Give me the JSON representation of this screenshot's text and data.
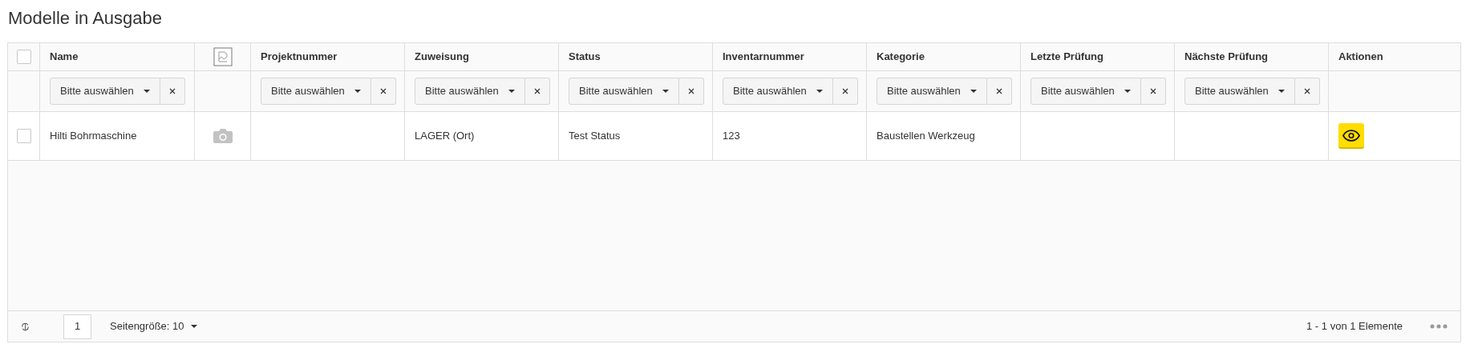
{
  "title": "Modelle in Ausgabe",
  "table": {
    "select_all": {
      "checked": false
    },
    "columns": [
      {
        "kind": "text",
        "label": "Name",
        "filter": "Bitte auswählen"
      },
      {
        "kind": "image"
      },
      {
        "kind": "text",
        "label": "Projektnummer",
        "filter": "Bitte auswählen"
      },
      {
        "kind": "text",
        "label": "Zuweisung",
        "filter": "Bitte auswählen"
      },
      {
        "kind": "text",
        "label": "Status",
        "filter": "Bitte auswählen"
      },
      {
        "kind": "text",
        "label": "Inventarnummer",
        "filter": "Bitte auswählen"
      },
      {
        "kind": "text",
        "label": "Kategorie",
        "filter": "Bitte auswählen"
      },
      {
        "kind": "text",
        "label": "Letzte Prüfung",
        "filter": "Bitte auswählen"
      },
      {
        "kind": "text",
        "label": "Nächste Prüfung",
        "filter": "Bitte auswählen"
      },
      {
        "kind": "text",
        "label": "Aktionen"
      }
    ],
    "rows": [
      {
        "checked": false,
        "cells": [
          {
            "kind": "text",
            "text": "Hilti Bohrmaschine"
          },
          {
            "kind": "photo"
          },
          {
            "kind": "empty"
          },
          {
            "kind": "text",
            "text": "LAGER (Ort)"
          },
          {
            "kind": "text",
            "text": "Test Status"
          },
          {
            "kind": "text",
            "text": "123"
          },
          {
            "kind": "text",
            "text": "Baustellen Werkzeug"
          },
          {
            "kind": "empty"
          },
          {
            "kind": "empty"
          },
          {
            "kind": "view"
          }
        ]
      }
    ]
  },
  "pager": {
    "page": "1",
    "page_size": "Seitengröße: 10",
    "summary": "1 - 1 von 1 Elemente"
  }
}
